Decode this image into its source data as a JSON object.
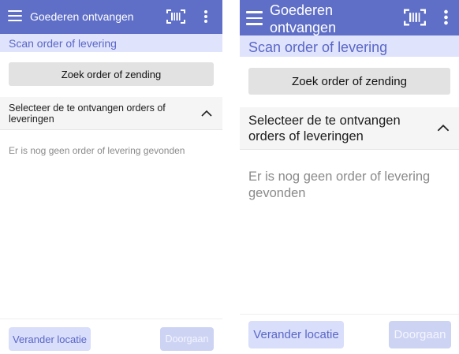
{
  "appbar": {
    "title": "Goederen ontvangen",
    "menu_icon": "hamburger-menu-icon",
    "barcode_icon": "barcode-scan-icon",
    "more_icon": "more-vertical-icon",
    "color": "#5f6fc7"
  },
  "scan": {
    "label": "Scan order of levering"
  },
  "search": {
    "button_label": "Zoek order of zending"
  },
  "section": {
    "title": "Selecteer de te ontvangen orders of leveringen",
    "toggle_icon": "chevron-up-icon"
  },
  "empty_message": "Er is nog geen order of levering gevonden",
  "footer": {
    "change_location_label": "Verander locatie",
    "continue_label": "Doorgaan"
  },
  "colors": {
    "accent": "#5f6fc7",
    "scanbar_bg": "#dfe3fb",
    "button_soft": "#d9defa",
    "disabled_button": "#cdd3f3"
  }
}
